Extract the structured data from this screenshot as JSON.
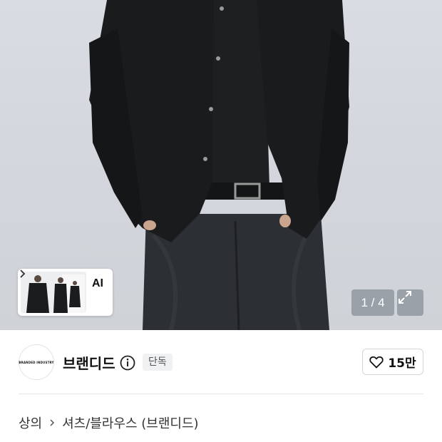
{
  "gallery": {
    "thumbnail_label": "AI",
    "counter": "1 / 4"
  },
  "brand": {
    "logo_text": "BRANDED INDUSTRY",
    "name": "브랜디드",
    "badge": "단독",
    "likes": "15만"
  },
  "breadcrumb": {
    "level1": "상의",
    "level2": "셔츠/블라우스 (브랜디드)"
  },
  "icons": [
    "chevron-right-icon",
    "expand-icon",
    "info-icon",
    "heart-icon"
  ]
}
